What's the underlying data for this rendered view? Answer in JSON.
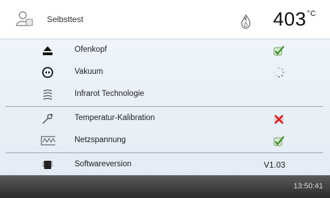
{
  "header": {
    "title": "Selbsttest",
    "temperature": "403",
    "unit": "°C"
  },
  "items": [
    {
      "icon": "furnace-head-icon",
      "label": "Ofenkopf",
      "status": "ok"
    },
    {
      "icon": "vacuum-icon",
      "label": "Vakuum",
      "status": "loading"
    },
    {
      "icon": "infrared-icon",
      "label": "Infrarot Technologie",
      "status": "none"
    },
    {
      "icon": "thermometer-calibration-icon",
      "label": "Temperatur-Kalibration",
      "status": "error"
    },
    {
      "icon": "voltage-icon",
      "label": "Netzspannung",
      "status": "ok"
    },
    {
      "icon": "chip-icon",
      "label": "Softwareversion",
      "value": "V1.03"
    }
  ],
  "footer": {
    "time": "13:50:41"
  },
  "colors": {
    "ok": "#4a9a3a",
    "error": "#cc1f1f",
    "panel": "#e8eff7",
    "footer": "#3a3a3a"
  }
}
